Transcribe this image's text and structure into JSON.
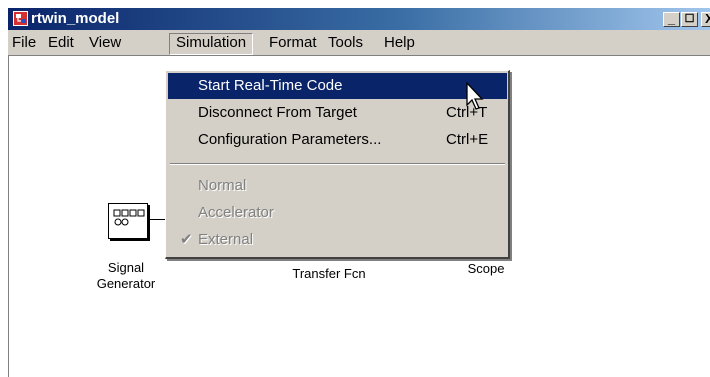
{
  "window": {
    "title": "rtwin_model",
    "minimize": "_",
    "maximize": "☐",
    "close": "X"
  },
  "menubar": [
    "File",
    "Edit",
    "View",
    "Simulation",
    "Format",
    "Tools",
    "Help"
  ],
  "simulation_menu": {
    "items": [
      {
        "label": "Start Real-Time Code",
        "shortcut": "",
        "state": "highlighted"
      },
      {
        "label": "Disconnect From Target",
        "shortcut": "Ctrl+T",
        "state": "enabled"
      },
      {
        "label": "Configuration Parameters...",
        "shortcut": "Ctrl+E",
        "state": "enabled"
      },
      {
        "label": "Normal",
        "shortcut": "",
        "state": "disabled"
      },
      {
        "label": "Accelerator",
        "shortcut": "",
        "state": "disabled"
      },
      {
        "label": "External",
        "shortcut": "",
        "state": "disabled-checked",
        "check": "✔"
      }
    ]
  },
  "blocks": {
    "signal_generator": {
      "line1": "Signal",
      "line2": "Generator"
    },
    "transfer_fcn": {
      "label": "Transfer Fcn"
    },
    "scope": {
      "label": "Scope"
    }
  },
  "colors": {
    "title_start": "#0a246a",
    "title_end": "#a6caf0",
    "menu_face": "#d4d0c8",
    "highlight": "#0a246a"
  }
}
